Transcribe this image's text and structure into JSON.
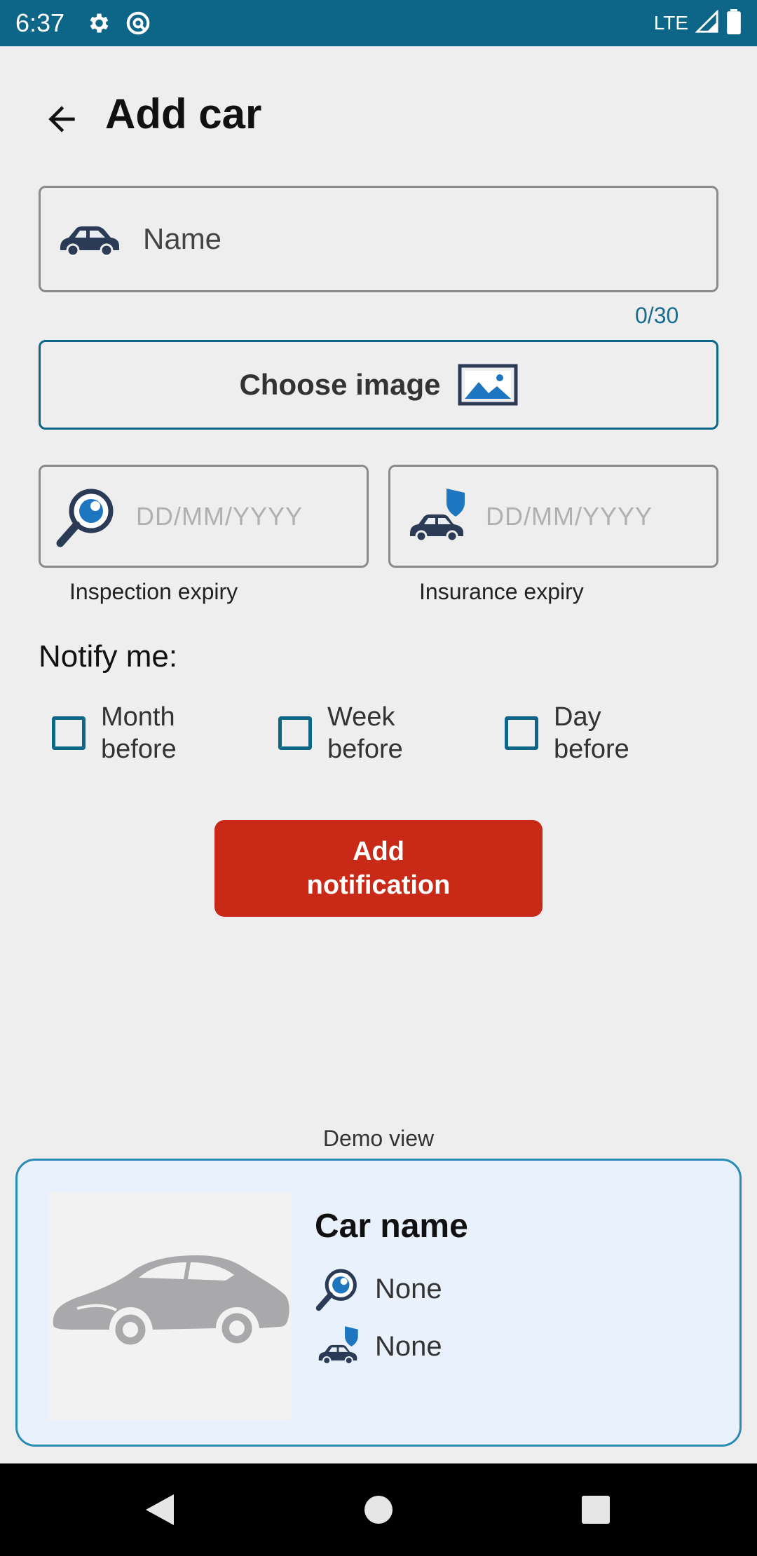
{
  "status_bar": {
    "time": "6:37",
    "network": "LTE"
  },
  "header": {
    "title": "Add car"
  },
  "form": {
    "name_placeholder": "Name",
    "name_counter": "0/30",
    "choose_image_label": "Choose image",
    "inspection": {
      "placeholder": "DD/MM/YYYY",
      "caption": "Inspection expiry"
    },
    "insurance": {
      "placeholder": "DD/MM/YYYY",
      "caption": "Insurance expiry"
    },
    "notify_title": "Notify me:",
    "options": [
      {
        "label": "Month before",
        "checked": false
      },
      {
        "label": "Week before",
        "checked": false
      },
      {
        "label": "Day before",
        "checked": false
      }
    ],
    "add_button_label": "Add notification"
  },
  "demo": {
    "label": "Demo view",
    "car_name": "Car name",
    "inspection_value": "None",
    "insurance_value": "None"
  },
  "colors": {
    "primary": "#0d6588",
    "accent_red": "#c92a18",
    "icon_dark": "#2b3a55",
    "icon_blue": "#1f76c0"
  }
}
